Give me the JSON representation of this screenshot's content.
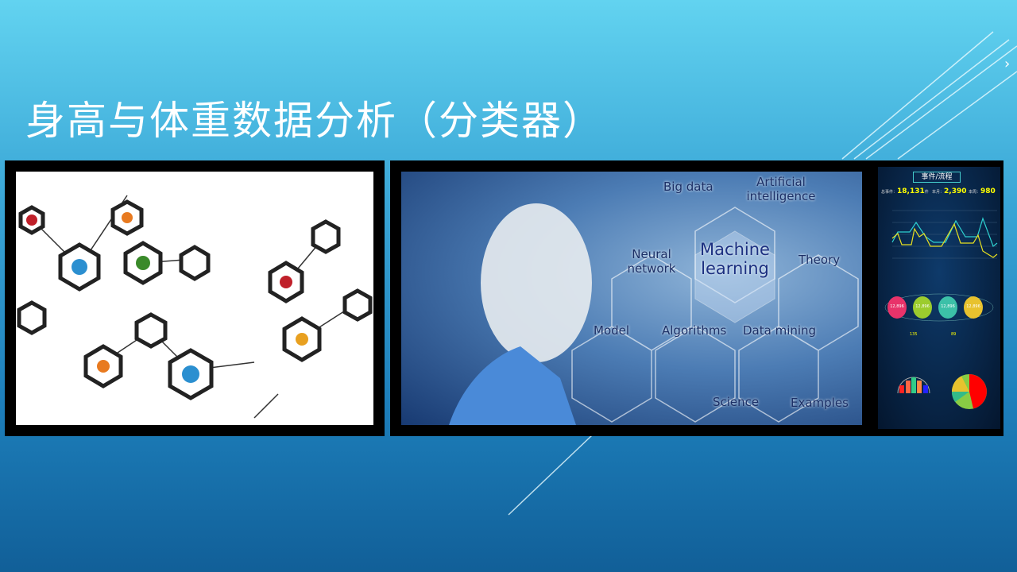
{
  "slide": {
    "title": "身高与体重数据分析（分类器）"
  },
  "ml_image": {
    "labels": [
      "Big data",
      "Artificial intelligence",
      "Neural network",
      "Machine learning",
      "Theory",
      "Model",
      "Algorithms",
      "Data mining",
      "Science",
      "Examples"
    ]
  },
  "dashboard": {
    "title": "事件/流程",
    "total_label": "总事件：",
    "total": "18,131",
    "unit": "件",
    "month_label": "本月：",
    "month": "2,390",
    "week_label": "本周：",
    "week": "980",
    "circles": [
      "12,896",
      "12,896",
      "12,896",
      "12,896"
    ],
    "circle_colors": [
      "#e8336a",
      "#9ccc2e",
      "#3cc0a8",
      "#e8c22e"
    ],
    "counts": [
      "135",
      "89"
    ]
  },
  "colors": {
    "bg_top": "#62d3f0",
    "bg_bottom": "#115f98",
    "title": "#ffffff"
  }
}
